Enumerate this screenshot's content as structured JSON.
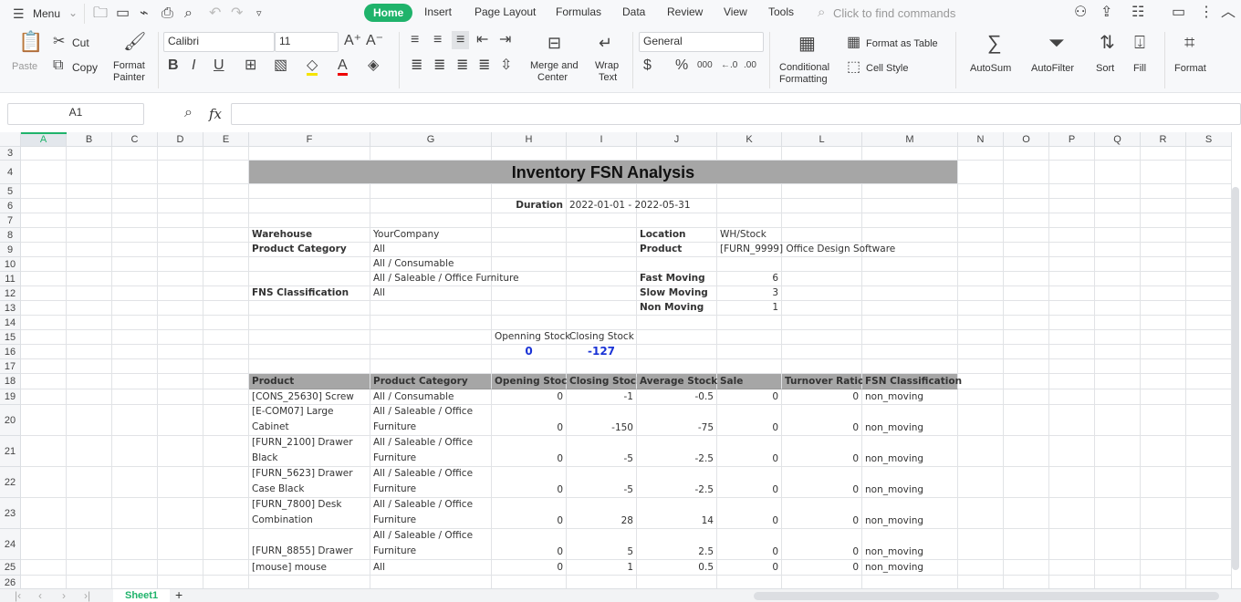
{
  "menu": {
    "label": "Menu",
    "quick": [
      "open-icon",
      "save-icon",
      "format-painter-icon",
      "print-icon",
      "print-preview-icon",
      "undo-icon",
      "redo-icon",
      "more-icon"
    ]
  },
  "tabs": [
    "Home",
    "Insert",
    "Page Layout",
    "Formulas",
    "Data",
    "Review",
    "View",
    "Tools"
  ],
  "active_tab": "Home",
  "search_placeholder": "Click to find commands",
  "ribbon": {
    "paste": "Paste",
    "cut": "Cut",
    "copy": "Copy",
    "format_painter": [
      "Format",
      "Painter"
    ],
    "font": "Calibri",
    "size": "11",
    "merge": [
      "Merge and",
      "Center"
    ],
    "wrap": [
      "Wrap",
      "Text"
    ],
    "number_format": "General",
    "conditional": [
      "Conditional",
      "Formatting"
    ],
    "format_table": "Format as Table",
    "cell_style": "Cell Style",
    "autosum": "AutoSum",
    "autofilter": "AutoFilter",
    "sort": "Sort",
    "fill": "Fill",
    "format": "Format",
    "accent": "#1fb36b"
  },
  "namebox": "A1",
  "fx": "fx",
  "columns": [
    "A",
    "B",
    "C",
    "D",
    "E",
    "F",
    "G",
    "H",
    "I",
    "J",
    "K",
    "L",
    "M",
    "N",
    "O",
    "P",
    "Q",
    "R",
    "S"
  ],
  "rows": [
    "3",
    "4",
    "5",
    "6",
    "7",
    "8",
    "9",
    "10",
    "11",
    "12",
    "13",
    "14",
    "15",
    "16",
    "17",
    "18",
    "19",
    "20",
    "21",
    "22",
    "23",
    "24",
    "25",
    "26"
  ],
  "cells": [
    {
      "ref": "F4",
      "v": "Inventory FSN Analysis"
    },
    {
      "ref": "H6",
      "v": "Duration"
    },
    {
      "ref": "I6",
      "v": "2022-01-01 - 2022-05-31"
    },
    {
      "ref": "F8",
      "v": "Warehouse"
    },
    {
      "ref": "G8",
      "v": "YourCompany"
    },
    {
      "ref": "J8",
      "v": "Location"
    },
    {
      "ref": "K8",
      "v": "WH/Stock"
    },
    {
      "ref": "F9",
      "v": "Product Category"
    },
    {
      "ref": "G9",
      "v": "All"
    },
    {
      "ref": "J9",
      "v": "Product"
    },
    {
      "ref": "K9",
      "v": "[FURN_9999] Office Design Software"
    },
    {
      "ref": "G10",
      "v": "All / Consumable"
    },
    {
      "ref": "G11",
      "v": "All / Saleable / Office Furniture"
    },
    {
      "ref": "J11",
      "v": "Fast Moving"
    },
    {
      "ref": "K11",
      "v": "6"
    },
    {
      "ref": "F12",
      "v": "FNS Classification"
    },
    {
      "ref": "G12",
      "v": "All"
    },
    {
      "ref": "J12",
      "v": "Slow Moving"
    },
    {
      "ref": "K12",
      "v": "3"
    },
    {
      "ref": "J13",
      "v": "Non Moving"
    },
    {
      "ref": "K13",
      "v": "1"
    },
    {
      "ref": "H15",
      "v": "Openning Stock"
    },
    {
      "ref": "I15",
      "v": "Closing Stock"
    },
    {
      "ref": "H16",
      "v": "0"
    },
    {
      "ref": "I16",
      "v": "-127"
    },
    {
      "ref": "F18",
      "v": "Product"
    },
    {
      "ref": "G18",
      "v": "Product Category"
    },
    {
      "ref": "H18",
      "v": "Opening Stock"
    },
    {
      "ref": "I18",
      "v": "Closing Stock"
    },
    {
      "ref": "J18",
      "v": "Average Stock"
    },
    {
      "ref": "K18",
      "v": "Sale"
    },
    {
      "ref": "L18",
      "v": "Turnover Ratio"
    },
    {
      "ref": "M18",
      "v": "FSN Classification"
    }
  ],
  "table": [
    [
      "[CONS_25630] Screw",
      "All / Consumable",
      "0",
      "-1",
      "-0.5",
      "0",
      "0",
      "non_moving"
    ],
    [
      "[E-COM07] Large Cabinet",
      "All / Saleable / Office Furniture",
      "0",
      "-150",
      "-75",
      "0",
      "0",
      "non_moving"
    ],
    [
      "[FURN_2100] Drawer Black",
      "All / Saleable / Office Furniture",
      "0",
      "-5",
      "-2.5",
      "0",
      "0",
      "non_moving"
    ],
    [
      "[FURN_5623] Drawer Case Black",
      "All / Saleable / Office Furniture",
      "0",
      "-5",
      "-2.5",
      "0",
      "0",
      "non_moving"
    ],
    [
      "[FURN_7800] Desk Combination",
      "All / Saleable / Office Furniture",
      "0",
      "28",
      "14",
      "0",
      "0",
      "non_moving"
    ],
    [
      "[FURN_8855] Drawer",
      "All / Saleable / Office Furniture",
      "0",
      "5",
      "2.5",
      "0",
      "0",
      "non_moving"
    ],
    [
      "[mouse] mouse",
      "All",
      "0",
      "1",
      "0.5",
      "0",
      "0",
      "non_moving"
    ]
  ],
  "sheet_tab": "Sheet1"
}
